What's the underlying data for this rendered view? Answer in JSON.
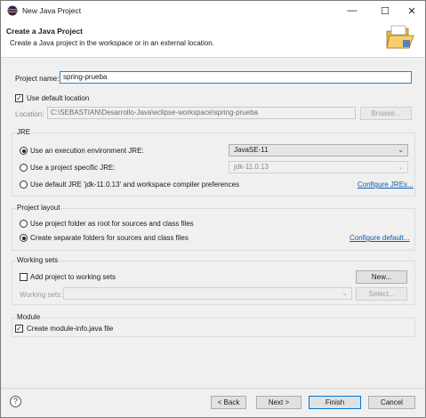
{
  "window": {
    "title": "New Java Project",
    "controls": {
      "minimize": "—",
      "maximize": "☐",
      "close": "✕"
    }
  },
  "banner": {
    "title": "Create a Java Project",
    "description": "Create a Java project in the workspace or in an external location."
  },
  "project": {
    "name_label": "Project name:",
    "name_value": "spring-prueba",
    "use_default_location_label": "Use default location",
    "use_default_location_checked": true,
    "location_label": "Location:",
    "location_value": "C:\\SEBASTIAN\\Desarrollo-Java\\eclipse-workspace\\spring-prueba",
    "browse_label": "Browse..."
  },
  "jre": {
    "group_title": "JRE",
    "option_env_label": "Use an execution environment JRE:",
    "option_env_value": "JavaSE-11",
    "option_specific_label": "Use a project specific JRE:",
    "option_specific_value": "jdk-11.0.13",
    "option_default_label": "Use default JRE 'jdk-11.0.13' and workspace compiler preferences",
    "configure_link": "Configure JREs..."
  },
  "layout": {
    "group_title": "Project layout",
    "option_root_label": "Use project folder as root for sources and class files",
    "option_separate_label": "Create separate folders for sources and class files",
    "configure_link": "Configure default..."
  },
  "working_sets": {
    "group_title": "Working sets",
    "add_label": "Add project to working sets",
    "new_label": "New...",
    "sets_label": "Working sets:",
    "select_label": "Select..."
  },
  "module": {
    "group_title": "Module",
    "create_label": "Create module-info.java file",
    "checked": true
  },
  "buttons": {
    "help": "?",
    "back": "< Back",
    "next": "Next >",
    "finish": "Finish",
    "cancel": "Cancel"
  }
}
